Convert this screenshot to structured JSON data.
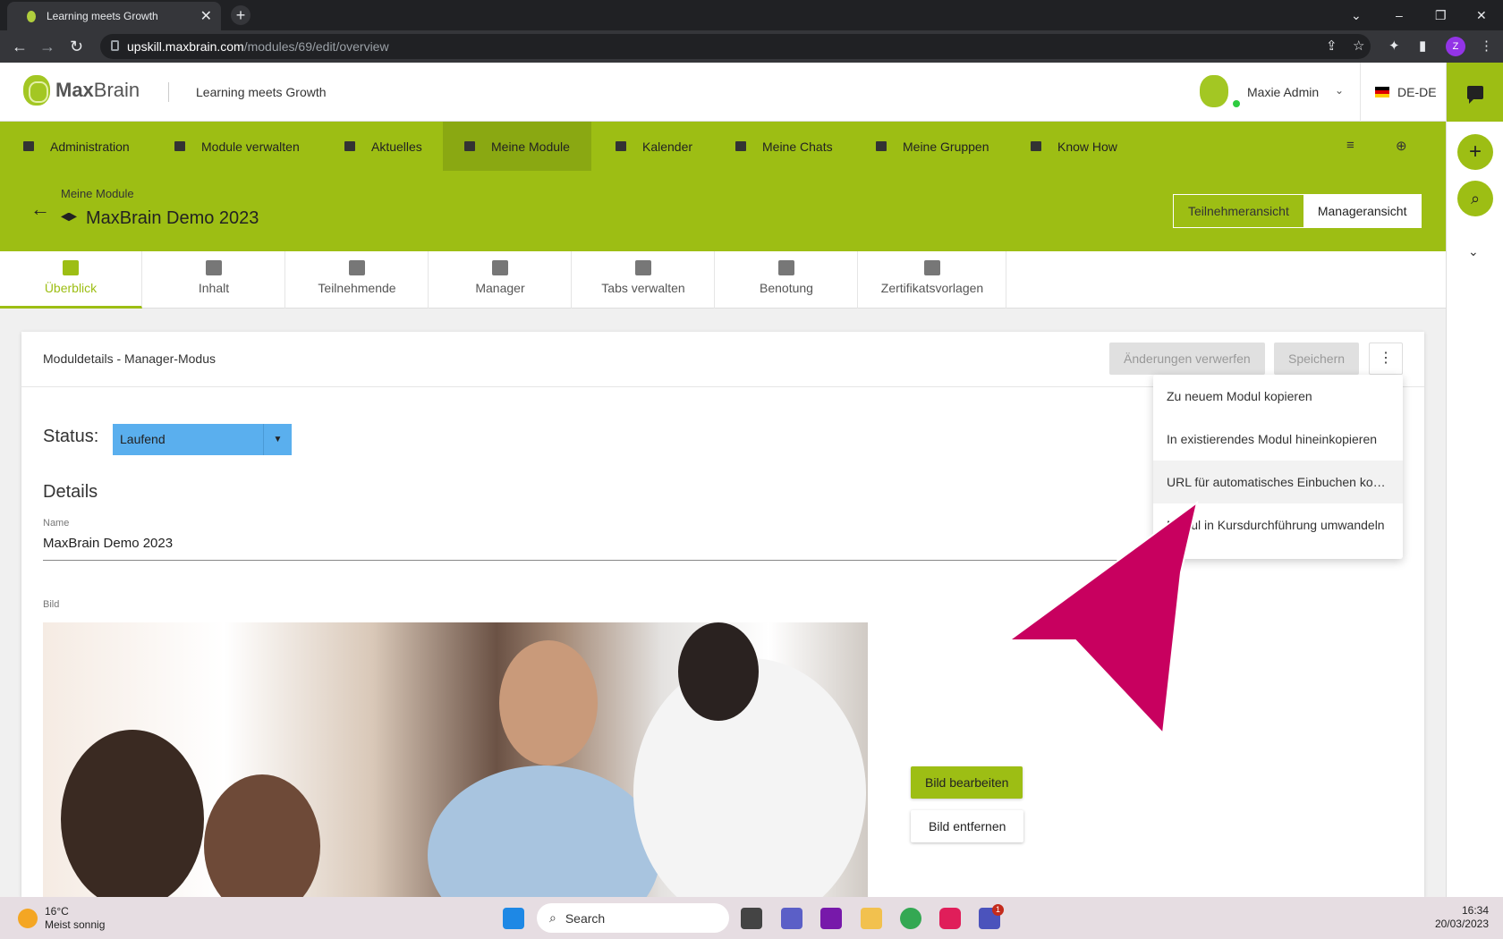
{
  "browser": {
    "tab_title": "Learning meets Growth",
    "url_domain": "upskill.maxbrain.com",
    "url_path": "/modules/69/edit/overview",
    "profile_initial": "Z"
  },
  "header": {
    "logo_max": "Max",
    "logo_brain": "Brain",
    "slogan": "Learning meets Growth",
    "user_name": "Maxie Admin",
    "language": "DE-DE"
  },
  "mainnav": [
    {
      "label": "Administration",
      "icon": "admin-icon"
    },
    {
      "label": "Module verwalten",
      "icon": "modules-icon"
    },
    {
      "label": "Aktuelles",
      "icon": "news-icon"
    },
    {
      "label": "Meine Module",
      "icon": "graduation-cap-icon",
      "active": true
    },
    {
      "label": "Kalender",
      "icon": "calendar-icon"
    },
    {
      "label": "Meine Chats",
      "icon": "chat-icon"
    },
    {
      "label": "Meine Gruppen",
      "icon": "groups-icon"
    },
    {
      "label": "Know How",
      "icon": "book-icon"
    }
  ],
  "page": {
    "breadcrumb": "Meine Module",
    "title": "MaxBrain Demo 2023",
    "view_participant": "Teilnehmeransicht",
    "view_manager": "Manageransicht"
  },
  "subtabs": [
    {
      "label": "Überblick",
      "icon": "dashboard-icon",
      "active": true
    },
    {
      "label": "Inhalt",
      "icon": "folder-icon"
    },
    {
      "label": "Teilnehmende",
      "icon": "people-icon"
    },
    {
      "label": "Manager",
      "icon": "manager-icon"
    },
    {
      "label": "Tabs verwalten",
      "icon": "window-icon"
    },
    {
      "label": "Benotung",
      "icon": "grade-icon"
    },
    {
      "label": "Zertifikatsvorlagen",
      "icon": "certificate-icon"
    }
  ],
  "card": {
    "title": "Moduldetails - Manager-Modus",
    "discard_label": "Änderungen verwerfen",
    "save_label": "Speichern",
    "status_label": "Status:",
    "status_value": "Laufend",
    "details_heading": "Details",
    "name_label": "Name",
    "name_value": "MaxBrain Demo 2023",
    "image_label": "Bild",
    "edit_image": "Bild bearbeiten",
    "remove_image": "Bild entfernen"
  },
  "menu": {
    "items": [
      "Zu neuem Modul kopieren",
      "In existierendes Modul hineinkopieren",
      "URL für automatisches Einbuchen kop…",
      "Modul in Kursdurchführung umwandeln"
    ]
  },
  "colors": {
    "brand": "#9dbe14",
    "annotation_arrow": "#c8005f"
  },
  "taskbar": {
    "temperature": "16°C",
    "weather": "Meist sonnig",
    "search_label": "Search",
    "time": "16:34",
    "date": "20/03/2023",
    "teams_badge": "1"
  }
}
